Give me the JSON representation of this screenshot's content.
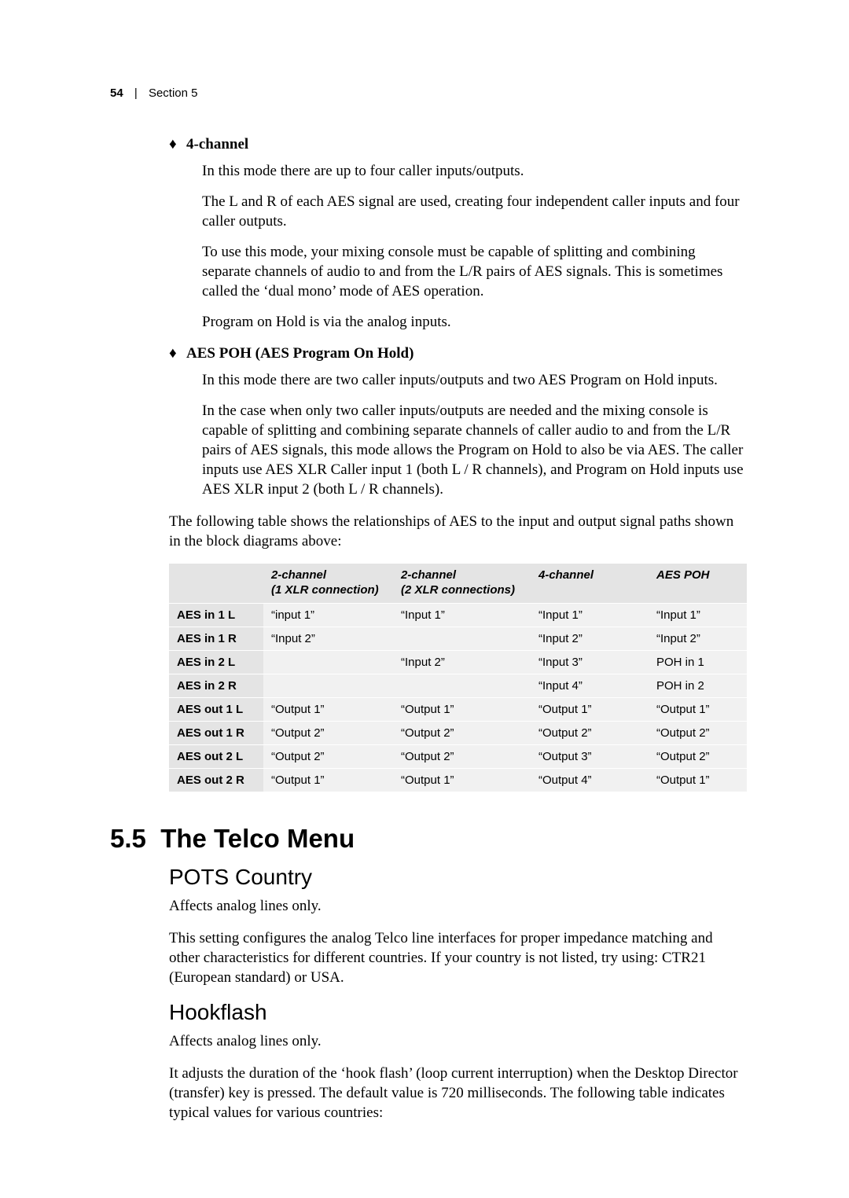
{
  "header": {
    "page_number": "54",
    "section_label": "Section 5"
  },
  "bullets": [
    {
      "title": "4-channel",
      "paras": [
        "In this mode there are up to four caller inputs/outputs.",
        "The L and R of each AES signal are used, creating four independent caller inputs and four caller outputs.",
        "To use this mode, your mixing console must be capable of splitting and combining separate channels of audio to and from the L/R pairs of AES signals. This is sometimes called the ‘dual mono’ mode of AES operation.",
        "Program on Hold is via the analog inputs."
      ]
    },
    {
      "title": "AES POH  (AES Program On Hold)",
      "paras": [
        "In this mode there are two caller inputs/outputs and two AES Program on Hold inputs.",
        "In the case when only two caller inputs/outputs are needed and the mixing console is capable of splitting and combining separate channels of caller audio to and from the L/R pairs of AES signals, this mode allows the Program on Hold to also be via AES. The caller inputs use AES XLR Caller input 1 (both L / R channels), and Program on Hold inputs use AES XLR input 2 (both L / R channels)."
      ]
    }
  ],
  "table_intro": "The following table shows the relationships of AES to the input and output signal paths shown in the block diagrams above:",
  "aes_table": {
    "headers": [
      "",
      "2-channel\n(1 XLR connection)",
      "2-channel\n(2 XLR connections)",
      "4-channel",
      "AES POH"
    ],
    "rows": [
      {
        "label": "AES in 1 L",
        "cells": [
          "“input 1”",
          "“Input 1”",
          "“Input 1”",
          "“Input 1”"
        ]
      },
      {
        "label": "AES in 1 R",
        "cells": [
          "“Input 2”",
          "",
          "“Input 2”",
          "“Input 2”"
        ]
      },
      {
        "label": "AES in 2 L",
        "cells": [
          "",
          "“Input 2”",
          "“Input 3”",
          "POH in 1"
        ]
      },
      {
        "label": "AES in 2 R",
        "cells": [
          "",
          "",
          "“Input 4”",
          "POH in 2"
        ]
      },
      {
        "label": "AES out 1 L",
        "cells": [
          "“Output 1”",
          "“Output 1”",
          "“Output 1”",
          "“Output 1”"
        ]
      },
      {
        "label": "AES out 1 R",
        "cells": [
          "“Output 2”",
          "“Output 2”",
          "“Output 2”",
          "“Output 2”"
        ]
      },
      {
        "label": "AES out 2 L",
        "cells": [
          "“Output 2”",
          "“Output 2”",
          "“Output 3”",
          "“Output 2”"
        ]
      },
      {
        "label": "AES out 2 R",
        "cells": [
          "“Output 1”",
          "“Output 1”",
          "“Output 4”",
          "“Output 1”"
        ]
      }
    ]
  },
  "section": {
    "number": "5.5",
    "title": "The Telco Menu"
  },
  "pots": {
    "heading": "POTS Country",
    "p1": "Affects analog lines only.",
    "p2": "This setting configures the analog Telco line interfaces for proper impedance matching and other characteristics for different countries. If your country is not listed, try using: CTR21 (European standard) or USA."
  },
  "hookflash": {
    "heading": "Hookflash",
    "p1": "Affects analog lines only.",
    "p2": "It adjusts the duration of the ‘hook flash’ (loop current interruption) when the Desktop Director (transfer) key is pressed. The default value is 720 milliseconds. The following table indicates typical values for various countries:"
  }
}
